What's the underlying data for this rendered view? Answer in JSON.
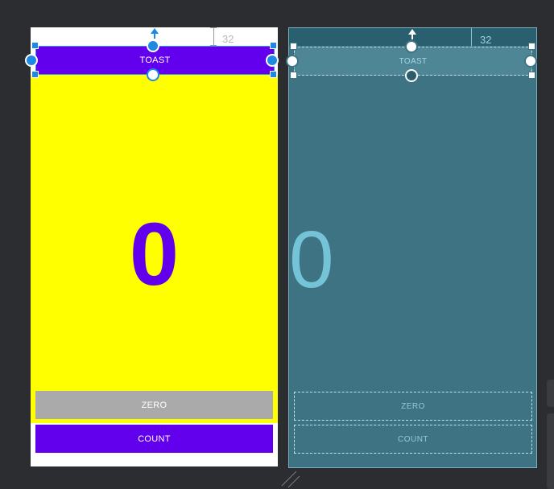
{
  "design": {
    "margin_label": "32",
    "toast_label": "TOAST",
    "count_value": "0",
    "zero_label": "ZERO",
    "count_label": "COUNT",
    "colors": {
      "primary": "#6200ee",
      "content_bg": "#ffff00",
      "zero_bg": "#aaaaaa",
      "selection": "#1e88e5"
    }
  },
  "blueprint": {
    "margin_label": "32",
    "toast_label": "TOAST",
    "count_value": "0",
    "zero_label": "ZERO",
    "count_label": "COUNT",
    "colors": {
      "background": "#3e7383",
      "text": "#74c3d6"
    }
  }
}
